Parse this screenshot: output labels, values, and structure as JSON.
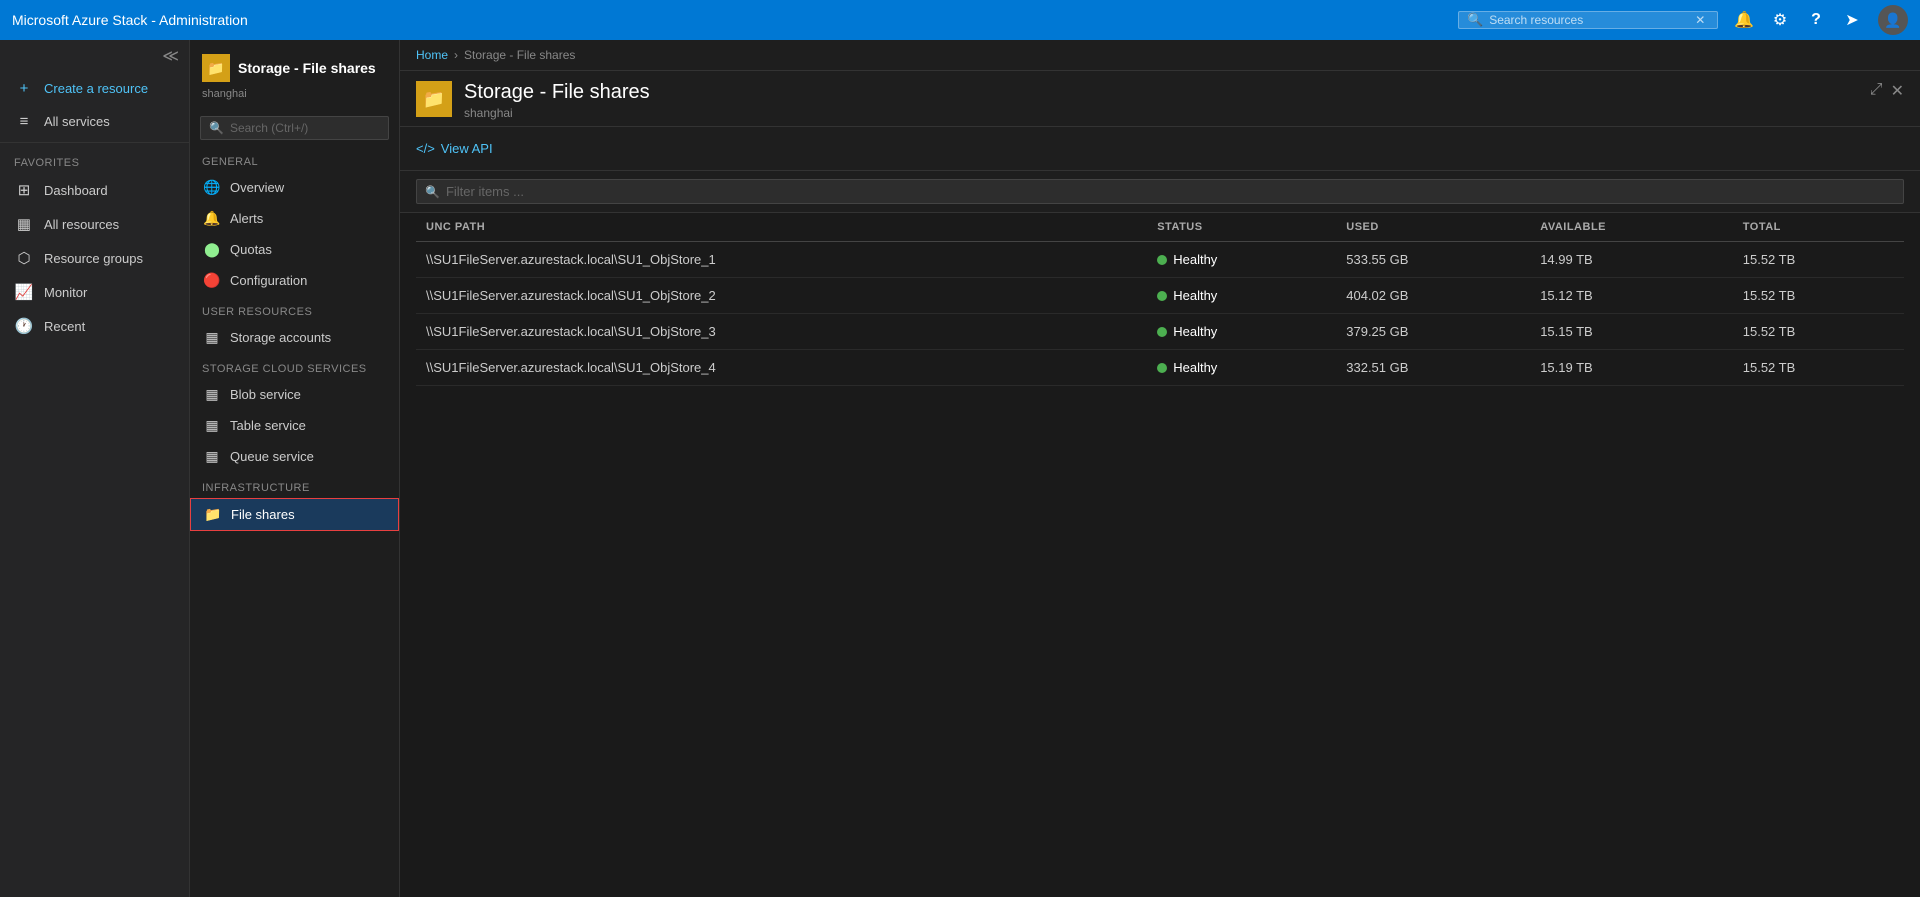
{
  "app": {
    "title": "Microsoft Azure Stack - Administration"
  },
  "topbar": {
    "title": "Microsoft Azure Stack - Administration",
    "search_placeholder": "Search resources",
    "close_icon": "✕"
  },
  "sidebar": {
    "create_label": "Create a resource",
    "services_label": "All services",
    "favorites_section": "FAVORITES",
    "items": [
      {
        "id": "dashboard",
        "label": "Dashboard",
        "icon": "⊞"
      },
      {
        "id": "all-resources",
        "label": "All resources",
        "icon": "▦"
      },
      {
        "id": "resource-groups",
        "label": "Resource groups",
        "icon": "⬡"
      },
      {
        "id": "monitor",
        "label": "Monitor",
        "icon": "📈"
      },
      {
        "id": "recent",
        "label": "Recent",
        "icon": "🕐"
      }
    ]
  },
  "nav_panel": {
    "title": "Storage - File shares",
    "subtitle": "shanghai",
    "search_placeholder": "Search (Ctrl+/)",
    "sections": {
      "general": "GENERAL",
      "user_resources": "USER RESOURCES",
      "storage_cloud_services": "STORAGE CLOUD SERVICES",
      "infrastructure": "INFRASTRUCTURE"
    },
    "items": [
      {
        "id": "overview",
        "label": "Overview",
        "section": "general",
        "icon": "🌐"
      },
      {
        "id": "alerts",
        "label": "Alerts",
        "section": "general",
        "icon": "🔔"
      },
      {
        "id": "quotas",
        "label": "Quotas",
        "section": "general",
        "icon": "⬤"
      },
      {
        "id": "configuration",
        "label": "Configuration",
        "section": "general",
        "icon": "🔴"
      },
      {
        "id": "storage-accounts",
        "label": "Storage accounts",
        "section": "user_resources",
        "icon": "▦"
      },
      {
        "id": "blob-service",
        "label": "Blob service",
        "section": "storage_cloud_services",
        "icon": "▦"
      },
      {
        "id": "table-service",
        "label": "Table service",
        "section": "storage_cloud_services",
        "icon": "▦"
      },
      {
        "id": "queue-service",
        "label": "Queue service",
        "section": "storage_cloud_services",
        "icon": "▦"
      },
      {
        "id": "file-shares",
        "label": "File shares",
        "section": "infrastructure",
        "icon": "📁",
        "active": true
      }
    ]
  },
  "breadcrumb": {
    "home": "Home",
    "current": "Storage - File shares"
  },
  "content": {
    "title": "Storage - File shares",
    "subtitle": "shanghai",
    "view_api_label": "View API",
    "filter_placeholder": "Filter items ...",
    "table": {
      "columns": [
        {
          "id": "unc_path",
          "label": "UNC PATH"
        },
        {
          "id": "status",
          "label": "STATUS"
        },
        {
          "id": "used",
          "label": "USED"
        },
        {
          "id": "available",
          "label": "AVAILABLE"
        },
        {
          "id": "total",
          "label": "TOTAL"
        }
      ],
      "rows": [
        {
          "unc_path": "\\\\SU1FileServer.azurestack.local\\SU1_ObjStore_1",
          "status": "Healthy",
          "used": "533.55 GB",
          "available": "14.99 TB",
          "total": "15.52 TB"
        },
        {
          "unc_path": "\\\\SU1FileServer.azurestack.local\\SU1_ObjStore_2",
          "status": "Healthy",
          "used": "404.02 GB",
          "available": "15.12 TB",
          "total": "15.52 TB"
        },
        {
          "unc_path": "\\\\SU1FileServer.azurestack.local\\SU1_ObjStore_3",
          "status": "Healthy",
          "used": "379.25 GB",
          "available": "15.15 TB",
          "total": "15.52 TB"
        },
        {
          "unc_path": "\\\\SU1FileServer.azurestack.local\\SU1_ObjStore_4",
          "status": "Healthy",
          "used": "332.51 GB",
          "available": "15.19 TB",
          "total": "15.52 TB"
        }
      ]
    }
  },
  "icons": {
    "search": "🔍",
    "bell": "🔔",
    "gear": "⚙",
    "question": "?",
    "send": "➤",
    "expand": "⤢",
    "close": "✕",
    "chevron_right": "›",
    "plus": "+",
    "bars": "≡",
    "star": "★",
    "code": "</>",
    "filter": "🔍"
  }
}
